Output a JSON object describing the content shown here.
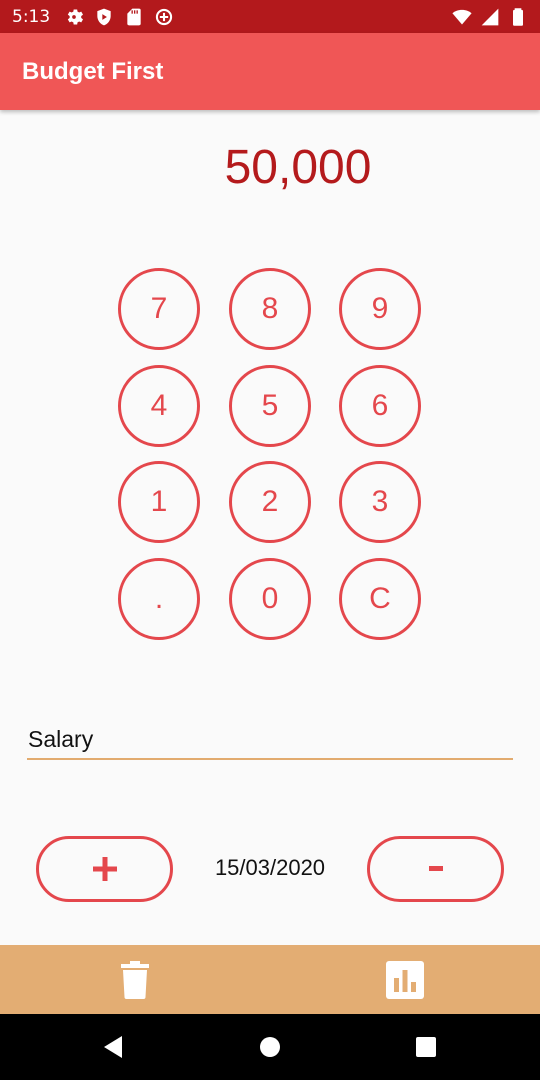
{
  "status_bar": {
    "time": "5:13",
    "left_icons": [
      "gear-icon",
      "play-protect-icon",
      "sd-card-icon",
      "data-saver-icon"
    ],
    "right_icons": [
      "wifi-icon",
      "cellular-icon",
      "battery-icon"
    ]
  },
  "app_bar": {
    "title": "Budget First"
  },
  "display": {
    "amount": "50,000"
  },
  "keypad": {
    "keys": [
      "7",
      "8",
      "9",
      "4",
      "5",
      "6",
      "1",
      "2",
      "3",
      ".",
      "0",
      "C"
    ]
  },
  "category": {
    "value": "Salary",
    "placeholder": ""
  },
  "actions": {
    "add_label": "+",
    "subtract_label": "-",
    "date": "15/03/2020"
  },
  "bottom_bar": {
    "left_icon": "trash-icon",
    "right_icon": "bar-chart-icon"
  },
  "nav_bar": {
    "buttons": [
      "back-icon",
      "home-icon",
      "recents-icon"
    ]
  },
  "colors": {
    "status_bar": "#b3191c",
    "app_bar": "#f05656",
    "accent": "#e4474c",
    "amount": "#b41a1c",
    "underline": "#e2ab6f",
    "bottom_bar": "#e3ad73",
    "background": "#fafafa"
  }
}
